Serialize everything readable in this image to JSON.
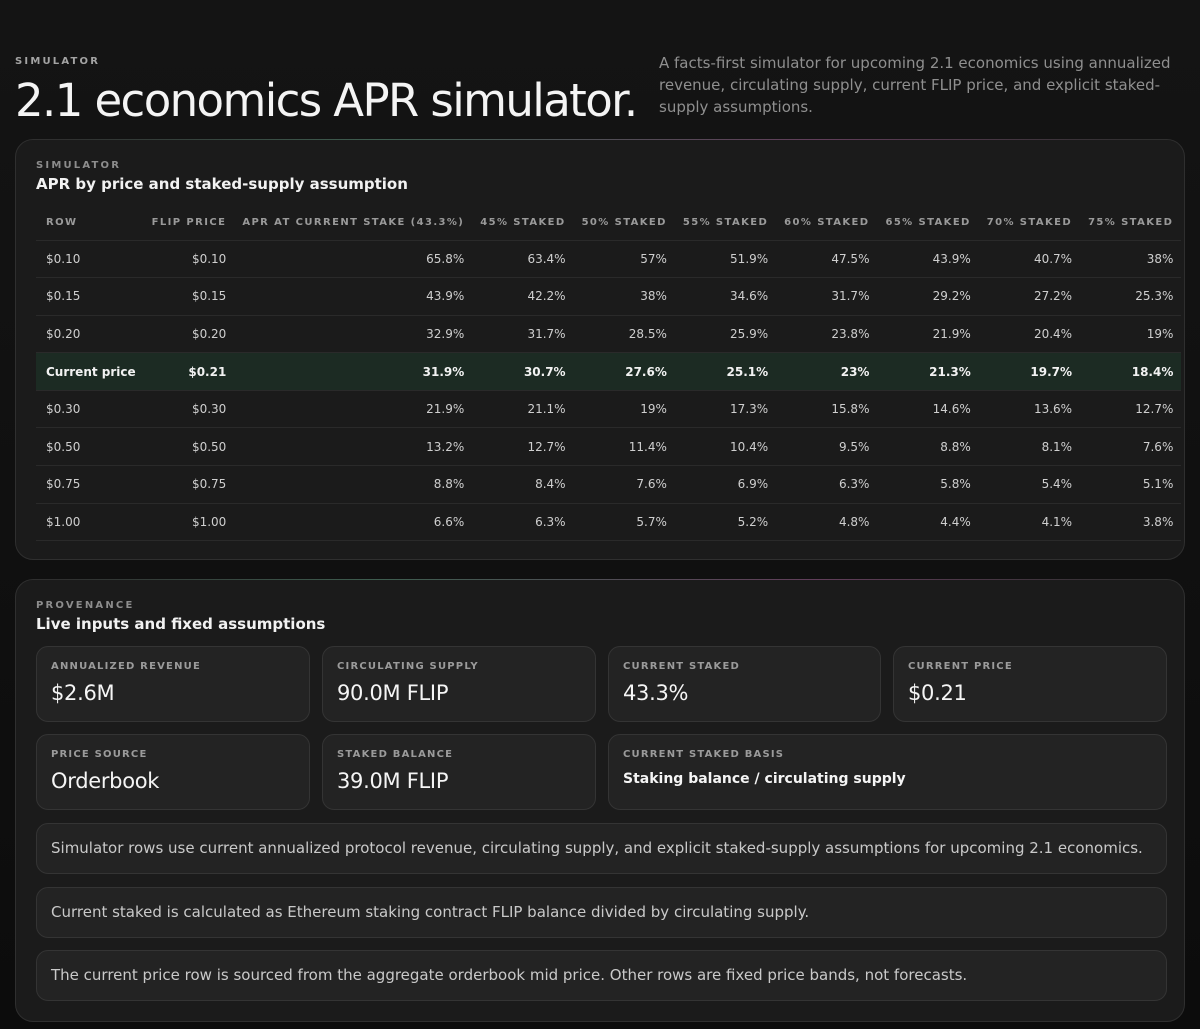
{
  "hero": {
    "eyebrow": "SIMULATOR",
    "title": "2.1 economics APR simulator.",
    "description": "A facts-first simulator for upcoming 2.1 economics using annualized revenue, circulating supply, current FLIP price, and explicit staked-supply assumptions."
  },
  "simulator": {
    "eyebrow": "SIMULATOR",
    "title": "APR by price and staked-supply assumption",
    "columns": [
      "ROW",
      "FLIP PRICE",
      "APR AT CURRENT STAKE (43.3%)",
      "45% STAKED",
      "50% STAKED",
      "55% STAKED",
      "60% STAKED",
      "65% STAKED",
      "70% STAKED",
      "75% STAKED"
    ],
    "rows": [
      {
        "cells": [
          "$0.10",
          "$0.10",
          "65.8%",
          "63.4%",
          "57%",
          "51.9%",
          "47.5%",
          "43.9%",
          "40.7%",
          "38%"
        ],
        "current": false
      },
      {
        "cells": [
          "$0.15",
          "$0.15",
          "43.9%",
          "42.2%",
          "38%",
          "34.6%",
          "31.7%",
          "29.2%",
          "27.2%",
          "25.3%"
        ],
        "current": false
      },
      {
        "cells": [
          "$0.20",
          "$0.20",
          "32.9%",
          "31.7%",
          "28.5%",
          "25.9%",
          "23.8%",
          "21.9%",
          "20.4%",
          "19%"
        ],
        "current": false
      },
      {
        "cells": [
          "Current price",
          "$0.21",
          "31.9%",
          "30.7%",
          "27.6%",
          "25.1%",
          "23%",
          "21.3%",
          "19.7%",
          "18.4%"
        ],
        "current": true
      },
      {
        "cells": [
          "$0.30",
          "$0.30",
          "21.9%",
          "21.1%",
          "19%",
          "17.3%",
          "15.8%",
          "14.6%",
          "13.6%",
          "12.7%"
        ],
        "current": false
      },
      {
        "cells": [
          "$0.50",
          "$0.50",
          "13.2%",
          "12.7%",
          "11.4%",
          "10.4%",
          "9.5%",
          "8.8%",
          "8.1%",
          "7.6%"
        ],
        "current": false
      },
      {
        "cells": [
          "$0.75",
          "$0.75",
          "8.8%",
          "8.4%",
          "7.6%",
          "6.9%",
          "6.3%",
          "5.8%",
          "5.4%",
          "5.1%"
        ],
        "current": false
      },
      {
        "cells": [
          "$1.00",
          "$1.00",
          "6.6%",
          "6.3%",
          "5.7%",
          "5.2%",
          "4.8%",
          "4.4%",
          "4.1%",
          "3.8%"
        ],
        "current": false
      }
    ]
  },
  "provenance": {
    "eyebrow": "PROVENANCE",
    "title": "Live inputs and fixed assumptions",
    "metrics": [
      {
        "label": "ANNUALIZED REVENUE",
        "value": "$2.6M"
      },
      {
        "label": "CIRCULATING SUPPLY",
        "value": "90.0M FLIP"
      },
      {
        "label": "CURRENT STAKED",
        "value": "43.3%"
      },
      {
        "label": "CURRENT PRICE",
        "value": "$0.21"
      },
      {
        "label": "PRICE SOURCE",
        "value": "Orderbook"
      },
      {
        "label": "STAKED BALANCE",
        "value": "39.0M FLIP"
      },
      {
        "label": "CURRENT STAKED BASIS",
        "value": "Staking balance / circulating supply"
      }
    ],
    "notes": [
      "Simulator rows use current annualized protocol revenue, circulating supply, and explicit staked-supply assumptions for upcoming 2.1 economics.",
      "Current staked is calculated as Ethereum staking contract FLIP balance divided by circulating supply.",
      "The current price row is sourced from the aggregate orderbook mid price. Other rows are fixed price bands, not forecasts."
    ]
  }
}
